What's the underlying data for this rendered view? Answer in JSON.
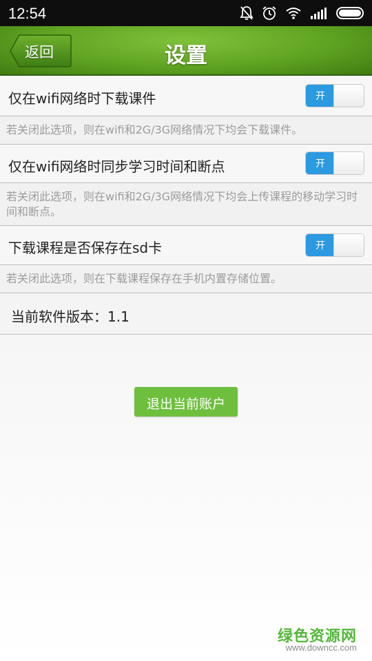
{
  "status_bar": {
    "time": "12:54",
    "icons": [
      "bell-off-icon",
      "alarm-icon",
      "wifi-icon",
      "signal-icon",
      "battery-icon"
    ]
  },
  "header": {
    "back_label": "返回",
    "title": "设置"
  },
  "settings": [
    {
      "label": "仅在wifi网络时下载课件",
      "toggle_label": "开",
      "toggle_on": true,
      "description": "若关闭此选项，则在wifi和2G/3G网络情况下均会下载课件。"
    },
    {
      "label": "仅在wifi网络时同步学习时间和断点",
      "toggle_label": "开",
      "toggle_on": true,
      "description": "若关闭此选项，则在wifi和2G/3G网络情况下均会上传课程的移动学习时间和断点。"
    },
    {
      "label": "下载课程是否保存在sd卡",
      "toggle_label": "开",
      "toggle_on": true,
      "description": "若关闭此选项，则在下载课程保存在手机内置存储位置。"
    }
  ],
  "version": {
    "text": "当前软件版本：1.1"
  },
  "logout": {
    "label": "退出当前账户"
  },
  "watermark": {
    "main": "绿色资源网",
    "sub": "www.downcc.com"
  },
  "colors": {
    "header_green": "#5fa322",
    "toggle_blue": "#2b9ae0",
    "logout_green": "#6fbf3f"
  }
}
